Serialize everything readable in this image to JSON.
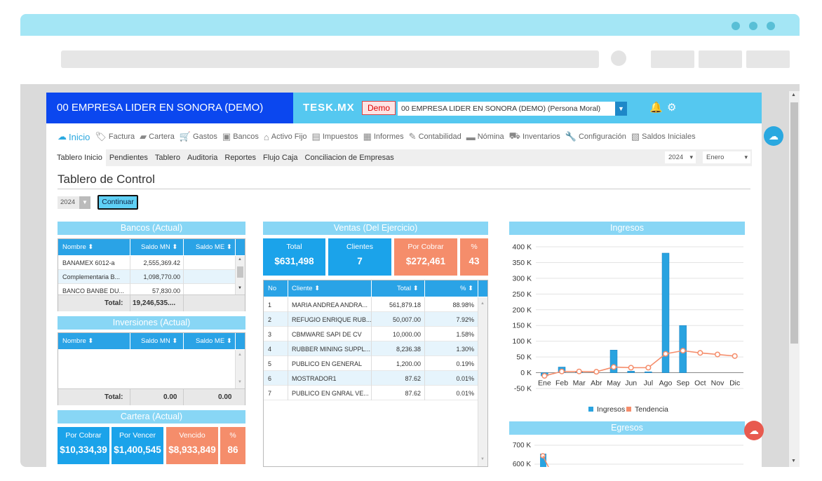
{
  "app": {
    "company_title": "00 EMPRESA LIDER EN SONORA (DEMO)",
    "logo": "TESK.MX",
    "demo_badge": "Demo",
    "company_select": "00 EMPRESA LIDER EN SONORA (DEMO) (Persona Moral)",
    "bell_icon": "bell-icon",
    "gear_icon": "gear-icon"
  },
  "menu": [
    {
      "label": "Inicio",
      "icon": "cloud-icon",
      "glyph": "☁"
    },
    {
      "label": "Factura",
      "icon": "tag-icon",
      "glyph": "🏷"
    },
    {
      "label": "Cartera",
      "icon": "briefcase-icon",
      "glyph": "▰"
    },
    {
      "label": "Gastos",
      "icon": "cart-icon",
      "glyph": "🛒"
    },
    {
      "label": "Bancos",
      "icon": "bank-icon",
      "glyph": "▣"
    },
    {
      "label": "Activo Fijo",
      "icon": "house-icon",
      "glyph": "⌂"
    },
    {
      "label": "Impuestos",
      "icon": "boxes-icon",
      "glyph": "▤"
    },
    {
      "label": "Informes",
      "icon": "report-icon",
      "glyph": "▦"
    },
    {
      "label": "Contabilidad",
      "icon": "ledger-icon",
      "glyph": "✎"
    },
    {
      "label": "Nómina",
      "icon": "card-icon",
      "glyph": "▬"
    },
    {
      "label": "Inventarios",
      "icon": "dolly-icon",
      "glyph": "⛟"
    },
    {
      "label": "Configuración",
      "icon": "wrench-icon",
      "glyph": "🔧"
    },
    {
      "label": "Saldos Iniciales",
      "icon": "doc-user-icon",
      "glyph": "▧"
    }
  ],
  "submenu": [
    "Tablero Inicio",
    "Pendientes",
    "Tablero",
    "Auditoria",
    "Reportes",
    "Flujo Caja",
    "Conciliacion de Empresas"
  ],
  "year_select": "2024",
  "month_select": "Enero",
  "page_title": "Tablero de Control",
  "filter_year": "2024",
  "continue_button": "Continuar",
  "bancos": {
    "title": "Bancos (Actual)",
    "headers": [
      "Nombre",
      "Saldo MN",
      "Saldo ME"
    ],
    "rows": [
      [
        "BANAMEX 6012-a",
        "2,555,369.42",
        ""
      ],
      [
        "Complementaria B...",
        "1,098,770.00",
        ""
      ],
      [
        "BANCO BANBE DU...",
        "57,830.00",
        ""
      ]
    ],
    "total_label": "Total:",
    "total_mn": "19,246,535....",
    "total_me": ""
  },
  "inversiones": {
    "title": "Inversiones (Actual)",
    "headers": [
      "Nombre",
      "Saldo MN",
      "Saldo ME"
    ],
    "total_label": "Total:",
    "total_mn": "0.00",
    "total_me": "0.00"
  },
  "cartera": {
    "title": "Cartera (Actual)",
    "kpis": [
      {
        "label": "Por Cobrar",
        "value": "$10,334,39"
      },
      {
        "label": "Por Vencer",
        "value": "$1,400,545"
      },
      {
        "label": "Vencido",
        "value": "$8,933,849"
      },
      {
        "label": "%",
        "value": "86"
      }
    ]
  },
  "ventas": {
    "title": "Ventas (Del Ejercicio)",
    "kpis": [
      {
        "label": "Total",
        "value": "$631,498"
      },
      {
        "label": "Clientes",
        "value": "7"
      },
      {
        "label": "Por Cobrar",
        "value": "$272,461"
      },
      {
        "label": "%",
        "value": "43"
      }
    ],
    "headers": [
      "No",
      "Cliente",
      "Total",
      "%"
    ],
    "rows": [
      [
        "1",
        "MARIA ANDREA ANDRA...",
        "561,879.18",
        "88.98%"
      ],
      [
        "2",
        "REFUGIO ENRIQUE RUB...",
        "50,007.00",
        "7.92%"
      ],
      [
        "3",
        "CBMWARE SAPI DE CV",
        "10,000.00",
        "1.58%"
      ],
      [
        "4",
        "RUBBER MINING SUPPL...",
        "8,236.38",
        "1.30%"
      ],
      [
        "5",
        "PUBLICO EN GENERAL",
        "1,200.00",
        "0.19%"
      ],
      [
        "6",
        "MOSTRADOR1",
        "87.62",
        "0.01%"
      ],
      [
        "7",
        "PUBLICO EN GNRAL VE...",
        "87.62",
        "0.01%"
      ]
    ]
  },
  "ingresos": {
    "title": "Ingresos",
    "legend": [
      "Ingresos",
      "Tendencia"
    ],
    "colors": {
      "bar": "#29a3e0",
      "line": "#f58d6b"
    }
  },
  "egresos": {
    "title": "Egresos",
    "yticks": [
      "700 K",
      "600 K"
    ]
  },
  "chart_data": {
    "type": "bar",
    "title": "Ingresos",
    "categories": [
      "Ene",
      "Feb",
      "Mar",
      "Abr",
      "May",
      "Jun",
      "Jul",
      "Ago",
      "Sep",
      "Oct",
      "Nov",
      "Dic"
    ],
    "yticks": [
      "400 K",
      "350 K",
      "300 K",
      "250 K",
      "200 K",
      "150 K",
      "100 K",
      "50 K",
      "0 K",
      "-50 K"
    ],
    "ylim": [
      -50000,
      400000
    ],
    "series": [
      {
        "name": "Ingresos",
        "type": "bar",
        "values": [
          -10000,
          18000,
          2000,
          0,
          72000,
          5000,
          3000,
          380000,
          150000,
          0,
          0,
          0
        ]
      },
      {
        "name": "Tendencia",
        "type": "line",
        "values": [
          -10000,
          4000,
          4000,
          3000,
          18000,
          16000,
          16000,
          60000,
          70000,
          63000,
          58000,
          53000
        ]
      }
    ]
  }
}
